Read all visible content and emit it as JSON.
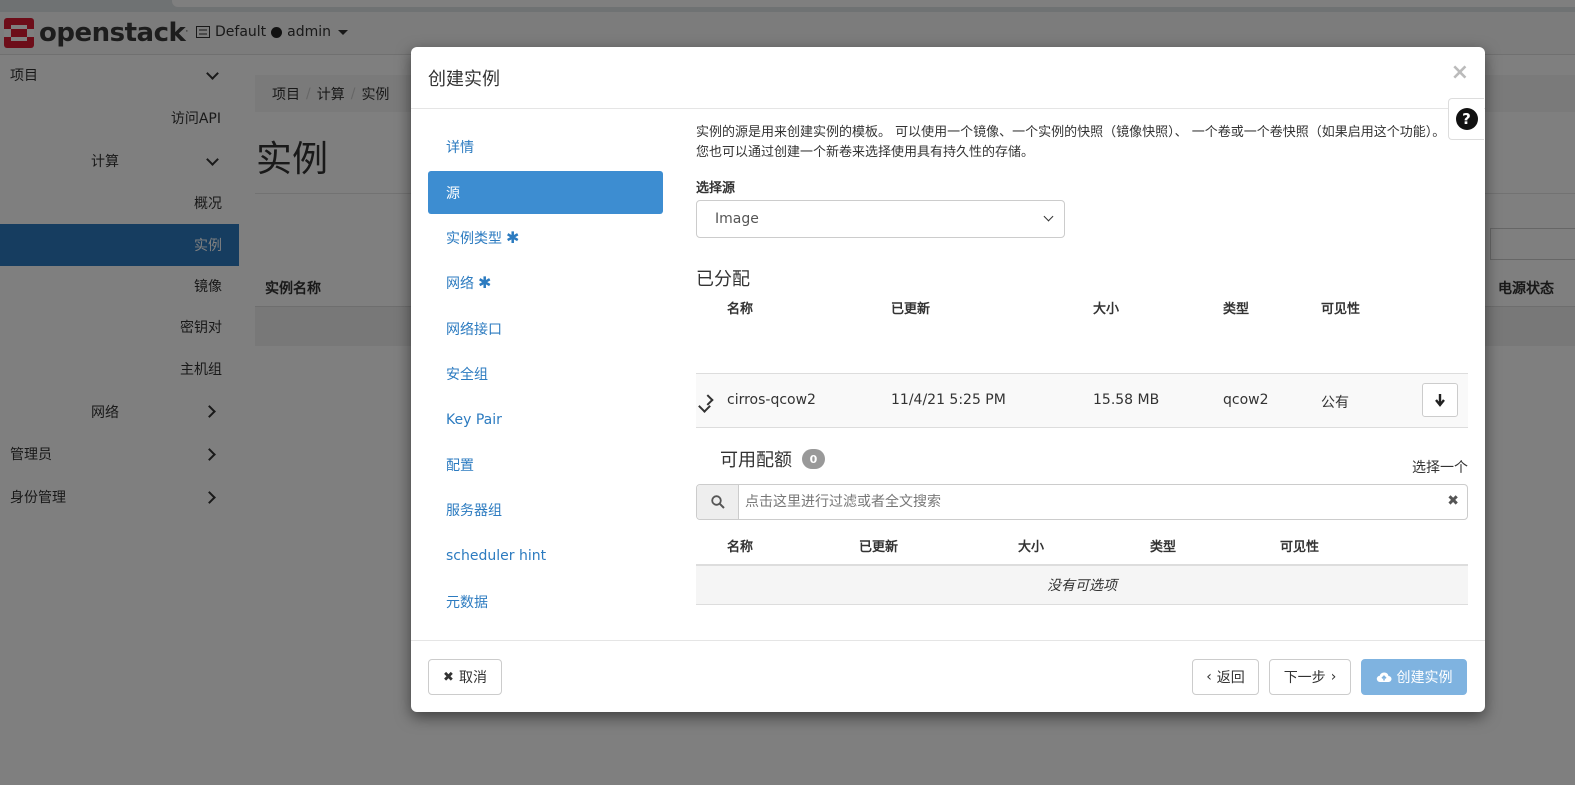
{
  "navbar": {
    "brand": "openstack",
    "brand_tm": ".",
    "domain": "Default",
    "user": "admin"
  },
  "sidebar": {
    "project": "项目",
    "api_access": "访问API",
    "compute": "计算",
    "overview": "概况",
    "instances": "实例",
    "images": "镜像",
    "key_pairs": "密钥对",
    "server_groups": "主机组",
    "network": "网络",
    "admin": "管理员",
    "identity": "身份管理"
  },
  "main": {
    "breadcrumb": [
      "项目",
      "计算",
      "实例"
    ],
    "breadcrumb_sep": "/",
    "title": "实例",
    "col_name": "实例名称",
    "col_power": "电源状态"
  },
  "modal": {
    "title": "创建实例",
    "close": "×",
    "help": "?",
    "steps": [
      {
        "label": "详情",
        "required": false
      },
      {
        "label": "源",
        "required": false
      },
      {
        "label": "实例类型",
        "required": true
      },
      {
        "label": "网络",
        "required": true
      },
      {
        "label": "网络接口",
        "required": false
      },
      {
        "label": "安全组",
        "required": false
      },
      {
        "label": "Key Pair",
        "required": false
      },
      {
        "label": "配置",
        "required": false
      },
      {
        "label": "服务器组",
        "required": false
      },
      {
        "label": "scheduler hint",
        "required": false
      },
      {
        "label": "元数据",
        "required": false
      }
    ],
    "required_mark": "✱",
    "description": "实例的源是用来创建实例的模板。 可以使用一个镜像、一个实例的快照（镜像快照）、 一个卷或一个卷快照（如果启用这个功能）。 您也可以通过创建一个新卷来选择使用具有持久性的存储。",
    "select_source_label": "选择源",
    "select_source_value": "Image",
    "allocated_title": "已分配",
    "alloc_headers": [
      "名称",
      "已更新",
      "大小",
      "类型",
      "可见性"
    ],
    "alloc_rows": [
      {
        "name": "cirros-qcow2",
        "updated": "11/4/21 5:25 PM",
        "size": "15.58 MB",
        "type": "qcow2",
        "visibility": "公有"
      }
    ],
    "available_title": "可用配额",
    "available_count": "0",
    "select_one": "选择一个",
    "search_placeholder": "点击这里进行过滤或者全文搜索",
    "avail_headers": [
      "名称",
      "已更新",
      "大小",
      "类型",
      "可见性"
    ],
    "empty_text": "没有可选项",
    "cancel": "取消",
    "back": "返回",
    "next": "下一步",
    "create": "创建实例"
  }
}
